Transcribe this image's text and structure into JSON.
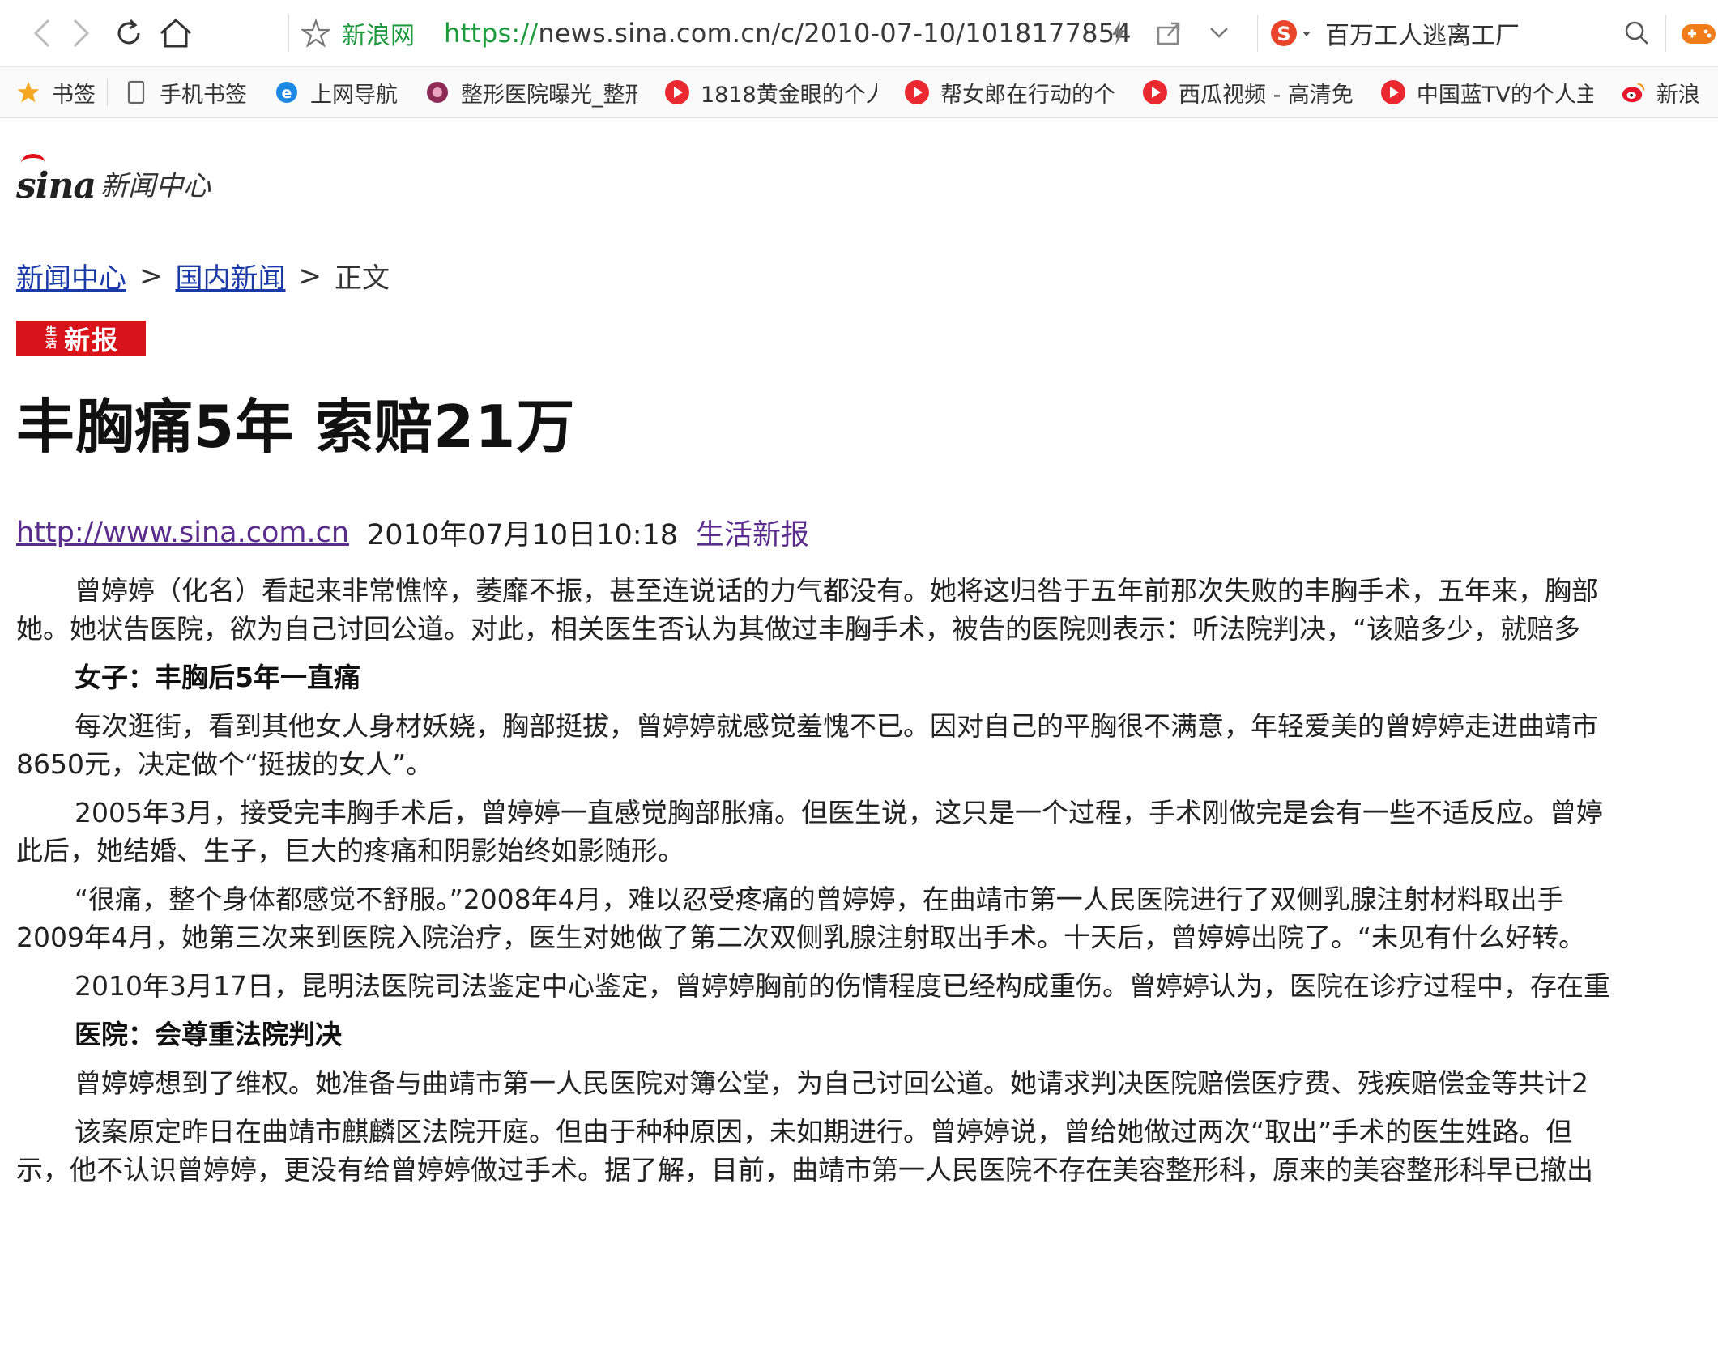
{
  "browser": {
    "site_name": "新浪网",
    "url_scheme": "https://",
    "url_rest": "news.sina.com.cn/c/2010-07-10/1018177854",
    "search_text": "百万工人逃离工厂"
  },
  "bookmarks": [
    {
      "label": "书签",
      "icon": "star-icon"
    },
    {
      "label": "手机书签",
      "icon": "phone-icon"
    },
    {
      "label": "上网导航",
      "icon": "ie-icon"
    },
    {
      "label": "整形医院曝光_整形",
      "icon": "site-icon"
    },
    {
      "label": "1818黄金眼的个人",
      "icon": "play-icon"
    },
    {
      "label": "帮女郎在行动的个",
      "icon": "play-icon"
    },
    {
      "label": "西瓜视频 - 高清免",
      "icon": "play-icon"
    },
    {
      "label": "中国蓝TV的个人主",
      "icon": "play-icon"
    },
    {
      "label": "新浪",
      "icon": "weibo-icon"
    }
  ],
  "page": {
    "logo_brand": "sina",
    "logo_section": "新闻中心",
    "breadcrumb": {
      "home": "新闻中心",
      "section": "国内新闻",
      "separator": ">",
      "current": "正文"
    },
    "source_logo_small": "生活",
    "source_logo_text": "新报",
    "title": "丰胸痛5年 索赔21万",
    "meta": {
      "link": "http://www.sina.com.cn",
      "datetime": "2010年07月10日10:18",
      "source": "生活新报"
    },
    "article": {
      "p1a": "曾婷婷（化名）看起来非常憔悴，萎靡不振，甚至连说话的力气都没有。她将这归咎于五年前那次失败的丰胸手术，五年来，胸部",
      "p1b": "她。她状告医院，欲为自己讨回公道。对此，相关医生否认为其做过丰胸手术，被告的医院则表示：听法院判决，“该赔多少，就赔多",
      "h1": "女子：丰胸后5年一直痛",
      "p2a": "每次逛街，看到其他女人身材妖娆，胸部挺拔，曾婷婷就感觉羞愧不已。因对自己的平胸很不满意，年轻爱美的曾婷婷走进曲靖市",
      "p2b": "8650元，决定做个“挺拔的女人”。",
      "p3a": "2005年3月，接受完丰胸手术后，曾婷婷一直感觉胸部胀痛。但医生说，这只是一个过程，手术刚做完是会有一些不适反应。曾婷",
      "p3b": "此后，她结婚、生子，巨大的疼痛和阴影始终如影随形。",
      "p4a": "“很痛，整个身体都感觉不舒服。”2008年4月，难以忍受疼痛的曾婷婷，在曲靖市第一人民医院进行了双侧乳腺注射材料取出手",
      "p4b": "2009年4月，她第三次来到医院入院治疗，医生对她做了第二次双侧乳腺注射取出手术。十天后，曾婷婷出院了。“未见有什么好转。",
      "p5a": "2010年3月17日，昆明法医院司法鉴定中心鉴定，曾婷婷胸前的伤情程度已经构成重伤。曾婷婷认为，医院在诊疗过程中，存在重",
      "h2": "医院：会尊重法院判决",
      "p6a": "曾婷婷想到了维权。她准备与曲靖市第一人民医院对簿公堂，为自己讨回公道。她请求判决医院赔偿医疗费、残疾赔偿金等共计2",
      "p7a": "该案原定昨日在曲靖市麒麟区法院开庭。但由于种种原因，未如期进行。曾婷婷说，曾给她做过两次“取出”手术的医生姓路。但",
      "p7b": "示，他不认识曾婷婷，更没有给曾婷婷做过手术。据了解，目前，曲靖市第一人民医院不存在美容整形科，原来的美容整形科早已撤出"
    }
  },
  "colors": {
    "url_green": "#1d9a3c",
    "link_blue": "#1a3aa8",
    "visited_purple": "#5a2d8c",
    "brand_red": "#d8131a"
  }
}
